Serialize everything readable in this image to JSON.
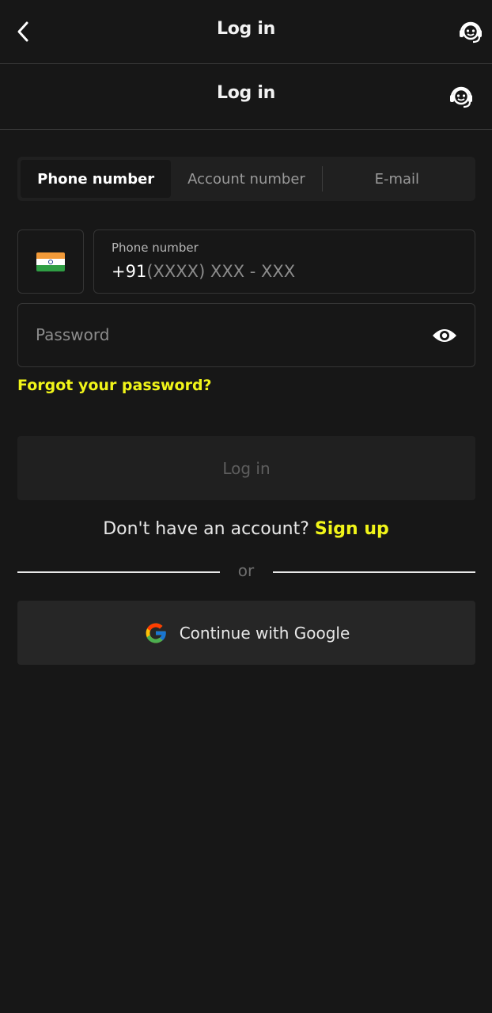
{
  "header": {
    "title": "Log in",
    "back_icon": "chevron-left-icon",
    "support_icon": "headset-support-icon"
  },
  "subheader": {
    "title": "Log in",
    "support_icon": "headset-support-icon"
  },
  "tabs": [
    {
      "label": "Phone number",
      "active": true
    },
    {
      "label": "Account number",
      "active": false
    },
    {
      "label": "E-mail",
      "active": false
    }
  ],
  "phone": {
    "country_flag": "india-flag-icon",
    "label": "Phone number",
    "prefix": "+91",
    "placeholder": "(XXXX) XXX - XXX"
  },
  "password": {
    "placeholder": "Password",
    "toggle_icon": "eye-icon"
  },
  "forgot_label": "Forgot your password?",
  "login_button": "Log in",
  "signup": {
    "question": "Don't have an account?",
    "link": "Sign up"
  },
  "divider_text": "or",
  "google_button": {
    "label": "Continue with Google",
    "icon": "google-icon"
  },
  "colors": {
    "background": "#171717",
    "accent": "#f1f519",
    "input_border": "#353535",
    "button_bg": "#202020"
  }
}
